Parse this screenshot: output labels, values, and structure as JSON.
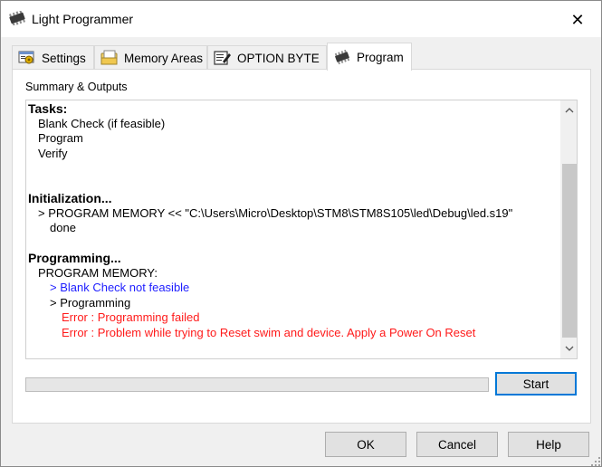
{
  "window": {
    "title": "Light Programmer",
    "close_glyph": "✕"
  },
  "tabs": [
    {
      "label": "Settings",
      "icon": "settings-tab-icon",
      "active": false
    },
    {
      "label": "Memory Areas",
      "icon": "memory-areas-tab-icon",
      "active": false
    },
    {
      "label": "OPTION BYTE",
      "icon": "option-byte-tab-icon",
      "active": false
    },
    {
      "label": "Program",
      "icon": "chip-icon",
      "active": true
    }
  ],
  "program_tab": {
    "group_label": "Summary & Outputs",
    "output_lines": [
      {
        "text": "Tasks:",
        "style": "heading",
        "indent": 0
      },
      {
        "text": "Blank Check (if feasible)",
        "style": "normal",
        "indent": 1
      },
      {
        "text": "Program",
        "style": "normal",
        "indent": 1
      },
      {
        "text": "Verify",
        "style": "normal",
        "indent": 1
      },
      {
        "text": "",
        "style": "normal",
        "indent": 0
      },
      {
        "text": "",
        "style": "normal",
        "indent": 0
      },
      {
        "text": "Initialization...",
        "style": "heading",
        "indent": 0
      },
      {
        "text": "> PROGRAM MEMORY << \"C:\\Users\\Micro\\Desktop\\STM8\\STM8S105\\led\\Debug\\led.s19\"",
        "style": "normal",
        "indent": 1
      },
      {
        "text": "done",
        "style": "normal",
        "indent": 2
      },
      {
        "text": "",
        "style": "normal",
        "indent": 0
      },
      {
        "text": "Programming...",
        "style": "heading",
        "indent": 0
      },
      {
        "text": "PROGRAM MEMORY:",
        "style": "normal",
        "indent": 1
      },
      {
        "text": "> Blank Check not feasible",
        "style": "blue",
        "indent": 2
      },
      {
        "text": "> Programming",
        "style": "normal",
        "indent": 2
      },
      {
        "text": "Error : Programming failed",
        "style": "red",
        "indent": 3
      },
      {
        "text": "Error : Problem while trying to Reset swim and device. Apply a Power On Reset",
        "style": "red",
        "indent": 3
      }
    ],
    "progress_percent": 0,
    "start_label": "Start"
  },
  "footer": {
    "ok_label": "OK",
    "cancel_label": "Cancel",
    "help_label": "Help"
  },
  "colors": {
    "error": "#ff1a1a",
    "info": "#1e1eff",
    "focus_border": "#0078d7"
  }
}
